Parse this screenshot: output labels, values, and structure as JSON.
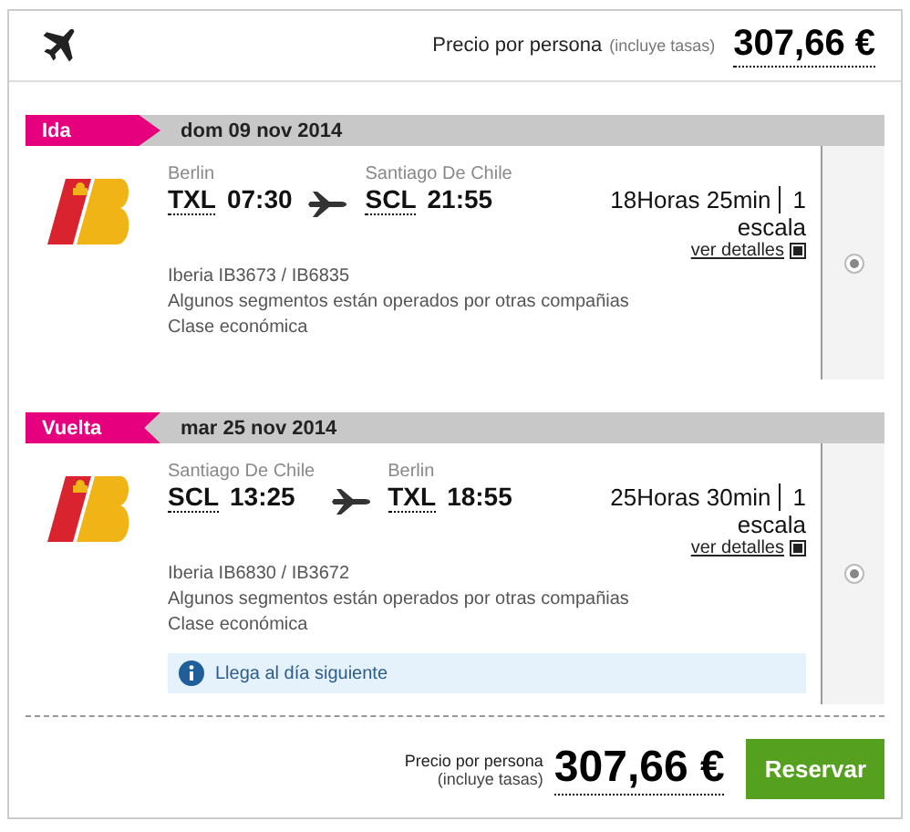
{
  "header": {
    "price_label": "Precio por persona",
    "price_note": "(incluye tasas)",
    "price": "307,66 €"
  },
  "legs": [
    {
      "kind": "outbound",
      "tag": "Ida",
      "date": "dom 09 nov 2014",
      "from_city": "Berlin",
      "from_code": "TXL",
      "from_time": "07:30",
      "to_city": "Santiago De Chile",
      "to_code": "SCL",
      "to_time": "21:55",
      "duration": "18Horas 25min",
      "stops": "1",
      "stops_label": "escala",
      "details_link": "ver detalles",
      "flights": "Iberia IB3673 / IB6835",
      "operated": "Algunos segmentos están operados por otras compañias",
      "cabin": "Clase económica",
      "selected": true
    },
    {
      "kind": "return",
      "tag": "Vuelta",
      "date": "mar 25 nov 2014",
      "from_city": "Santiago De Chile",
      "from_code": "SCL",
      "from_time": "13:25",
      "to_city": "Berlin",
      "to_code": "TXL",
      "to_time": "18:55",
      "duration": "25Horas 30min",
      "stops": "1",
      "stops_label": "escala",
      "details_link": "ver detalles",
      "flights": "Iberia IB6830 / IB3672",
      "operated": "Algunos segmentos están operados por otras compañias",
      "cabin": "Clase económica",
      "notice": "Llega al día siguiente",
      "selected": true
    }
  ],
  "footer": {
    "price_label": "Precio por persona",
    "price_note": "(incluye tasas)",
    "price": "307,66 €",
    "book_button": "Reservar"
  }
}
